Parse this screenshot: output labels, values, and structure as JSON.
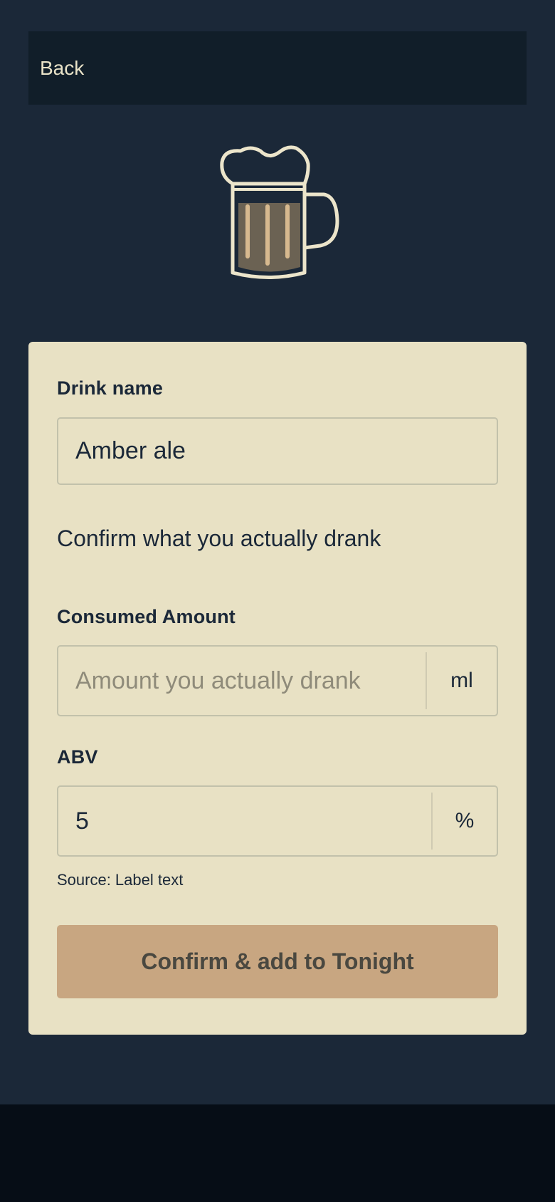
{
  "header": {
    "back_label": "Back"
  },
  "icon": {
    "name": "beer-mug-icon"
  },
  "form": {
    "drink_name": {
      "label": "Drink name",
      "value": "Amber ale"
    },
    "instruction": "Confirm what you actually drank",
    "consumed_amount": {
      "label": "Consumed Amount",
      "value": "",
      "placeholder": "Amount you actually drank",
      "unit": "ml"
    },
    "abv": {
      "label": "ABV",
      "value": "5",
      "unit": "%"
    },
    "source": "Source: Label text",
    "submit_label": "Confirm & add to Tonight"
  },
  "colors": {
    "background": "#1b2838",
    "header_bar": "#111e29",
    "card": "#e8e1c4",
    "button": "#c8a681",
    "accent_text": "#1b2838",
    "bottom_bar": "#060d16"
  }
}
